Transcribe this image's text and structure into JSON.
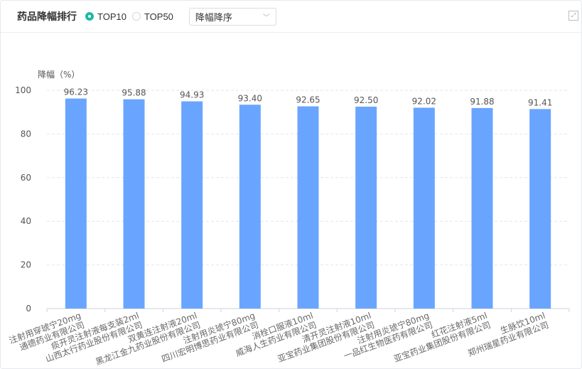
{
  "header": {
    "title": "药品降幅排行",
    "radio_top10": "TOP10",
    "radio_top50": "TOP50",
    "selected": "TOP10",
    "sort_select": "降幅降序"
  },
  "chart_data": {
    "type": "bar",
    "ylabel": "降幅（%）",
    "ylim": [
      0,
      100
    ],
    "yticks": [
      0,
      20,
      40,
      60,
      80,
      100
    ],
    "grid": true,
    "bar_color": "#69a5ff",
    "categories": [
      [
        "注射用穿琥宁20mg",
        "通德药业有限公司"
      ],
      [
        "痰开灵注射液每支装2ml",
        "山西太行药业股份有限公司"
      ],
      [
        "双黄连注射液20ml",
        "黑龙江金九药业股份有限公司"
      ],
      [
        "注射用炎琥宁80mg",
        "四川宏明博思药业有限公司"
      ],
      [
        "消栓口服液10ml",
        "威海人生药业有限公司"
      ],
      [
        "清开灵注射液10ml",
        "亚宝药业集团股份有限公司"
      ],
      [
        "注射用炎琥宁80mg",
        "一品红生物医药有限公司"
      ],
      [
        "红花注射液5ml",
        "亚宝药业集团股份有限公司"
      ],
      [
        "生脉饮10ml",
        "郑州瑞星药业有限公司"
      ]
    ],
    "values": [
      96.23,
      95.88,
      94.93,
      93.4,
      92.65,
      92.5,
      92.02,
      91.88,
      91.41
    ],
    "value_labels": [
      "96.23",
      "95.88",
      "94.93",
      "93.40",
      "92.65",
      "92.50",
      "92.02",
      "91.88",
      "91.41"
    ]
  }
}
